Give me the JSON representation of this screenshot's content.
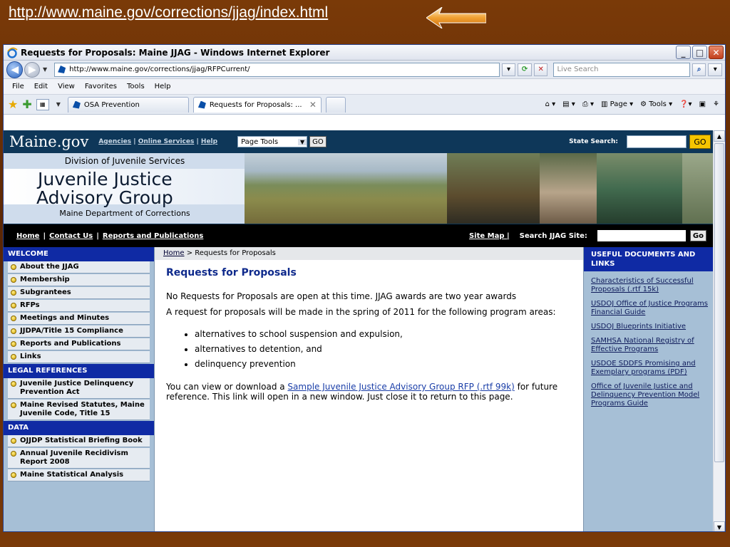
{
  "slide": {
    "url_text": "http://www.maine.gov/corrections/jjag/index.html"
  },
  "window": {
    "title": "Requests for Proposals: Maine JJAG - Windows Internet Explorer",
    "controls": [
      "_",
      "□",
      "✕"
    ]
  },
  "address": {
    "url": "http://www.maine.gov/corrections/jjag/RFPCurrent/",
    "search_placeholder": "Live Search"
  },
  "menu": [
    "File",
    "Edit",
    "View",
    "Favorites",
    "Tools",
    "Help"
  ],
  "tabs": [
    {
      "label": "OSA Prevention",
      "active": false
    },
    {
      "label": "Requests for Proposals: ...",
      "active": true
    }
  ],
  "toolbar_right": {
    "page": "Page",
    "tools": "Tools"
  },
  "site": {
    "logo": "Maine.gov",
    "top_links": [
      "Agencies",
      "Online Services",
      "Help"
    ],
    "page_tools": "Page Tools",
    "go": "GO",
    "state_search_label": "State Search:",
    "state_go": "GO"
  },
  "banner": {
    "division": "Division of Juvenile Services",
    "title_line1": "Juvenile Justice",
    "title_line2": "Advisory Group",
    "department": "Maine Department of Corrections"
  },
  "site_nav": {
    "links": [
      "Home",
      "Contact Us",
      "Reports and Publications"
    ],
    "site_map": "Site Map |",
    "search_label": "Search JJAG Site:",
    "go": "Go"
  },
  "left_nav": {
    "welcome": "WELCOME",
    "welcome_items": [
      "About the JJAG",
      "Membership",
      "Subgrantees",
      "RFPs",
      "Meetings and Minutes",
      "JJDPA/Title 15 Compliance",
      "Reports and Publications",
      "Links"
    ],
    "legal": "LEGAL REFERENCES",
    "legal_items": [
      "Juvenile Justice Delinquency Prevention Act",
      "Maine Revised Statutes, Maine Juvenile Code, Title 15"
    ],
    "data": "DATA",
    "data_items": [
      "OJJDP Statistical Briefing Book",
      "Annual Juvenile Recidivism Report 2008",
      "Maine Statistical Analysis"
    ]
  },
  "breadcrumb": {
    "home": "Home",
    "current": " > Requests for Proposals"
  },
  "main": {
    "title": "Requests for Proposals",
    "para1": "No Requests for Proposals are open at this time. JJAG awards are two year awards",
    "para2": "A request for proposals will be made in the spring of 2011 for the following program areas:",
    "bullets": [
      "alternatives to school suspension and expulsion,",
      "alternatives to detention, and",
      "delinquency prevention"
    ],
    "para3_before": "You can view or download a ",
    "sample_link": "Sample Juvenile Justice Advisory Group RFP (.rtf 99k)",
    "para3_after": " for future reference. This link will open in a new window. Just close it to return to this page."
  },
  "right_nav": {
    "heading": "USEFUL DOCUMENTS AND LINKS",
    "links": [
      "Characteristics of Successful Proposals (.rtf 15k)",
      "USDOJ Office of Justice Programs Financial Guide",
      "USDOJ Blueprints Initiative",
      "SAMHSA National Registry of Effective Programs",
      "USDOE SDDFS Promising and Exemplary programs (PDF)",
      "Office of Juvenile Justice and Delinquency Prevention Model Programs Guide"
    ]
  },
  "colors": {
    "slide_bg": "#5a2604",
    "site_header": "#0e3759",
    "nav_heading": "#0f2aa4",
    "nav_panel": "#a6bfd6",
    "go_yellow": "#f5c500"
  }
}
